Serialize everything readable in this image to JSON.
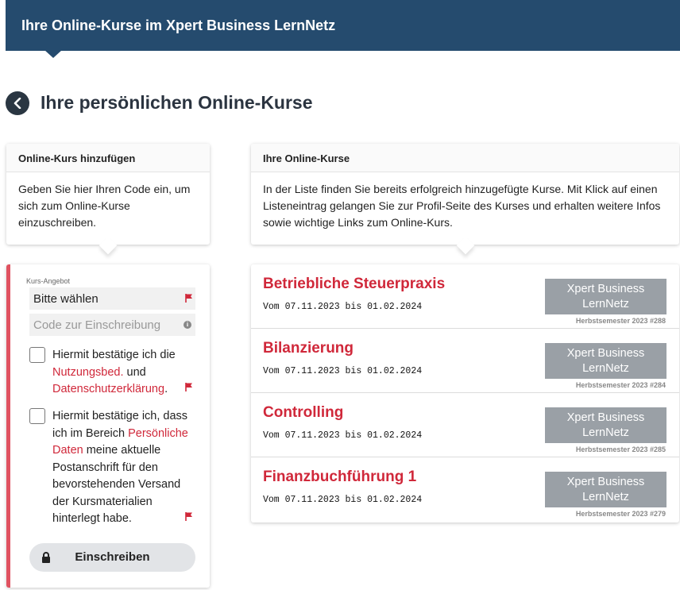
{
  "header": {
    "banner_title": "Ihre Online-Kurse im Xpert Business LernNetz",
    "page_title": "Ihre persönlichen Online-Kurse"
  },
  "add_course_info": {
    "title": "Online-Kurs hinzufügen",
    "text": "Geben Sie hier Ihren Code ein, um sich zum Online-Kurse einzuschreiben."
  },
  "my_courses_info": {
    "title": "Ihre Online-Kurse",
    "text": "In der Liste finden Sie bereits erfolgreich hinzugefügte Kurse. Mit Klick auf einen Listeneintrag gelangen Sie zur Profil-Seite des Kurses und erhalten weitere Infos sowie wichtige Links zum Online-Kurs."
  },
  "form": {
    "course_offer_label": "Kurs-Angebot",
    "course_offer_value": "Bitte wählen",
    "code_placeholder": "Code zur Einschreibung",
    "consent1": {
      "prefix": "Hiermit bestätige ich die ",
      "link1": "Nutzungsbed.",
      "middle": " und ",
      "link2": "Datenschutzerklärung",
      "suffix": "."
    },
    "consent2": {
      "prefix": "Hiermit bestätige ich, dass ich im Bereich ",
      "link": "Persönliche Daten",
      "suffix": " meine aktuelle Postanschrift für den bevorstehenden Versand der Kursmaterialien hinterlegt habe."
    },
    "submit_label": "Einschreiben"
  },
  "courses": [
    {
      "title": "Betriebliche Steuerpraxis",
      "dates": "Vom 07.11.2023 bis 01.02.2024",
      "provider": "Xpert Business LernNetz",
      "semester": "Herbstsemester 2023 #288"
    },
    {
      "title": "Bilanzierung",
      "dates": "Vom 07.11.2023 bis 01.02.2024",
      "provider": "Xpert Business LernNetz",
      "semester": "Herbstsemester 2023 #284"
    },
    {
      "title": "Controlling",
      "dates": "Vom 07.11.2023 bis 01.02.2024",
      "provider": "Xpert Business LernNetz",
      "semester": "Herbstsemester 2023 #285"
    },
    {
      "title": "Finanzbuchführung 1",
      "dates": "Vom 07.11.2023 bis 01.02.2024",
      "provider": "Xpert Business LernNetz",
      "semester": "Herbstsemester 2023 #279"
    }
  ],
  "colors": {
    "banner": "#254b6e",
    "accent_red": "#d0283a",
    "badge_gray": "#9aa0a6"
  },
  "icons": {
    "back": "chevron-left-icon",
    "required": "flag-icon",
    "info": "info-icon",
    "lock": "lock-icon"
  }
}
